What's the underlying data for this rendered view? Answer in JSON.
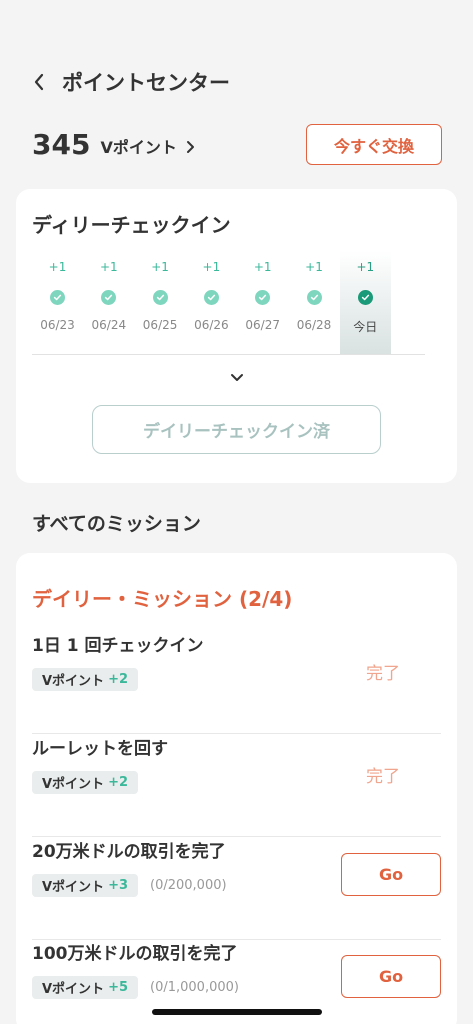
{
  "header": {
    "title": "ポイントセンター",
    "back_icon": "chevron-left-icon"
  },
  "points": {
    "value": "345",
    "unit": "Vポイント",
    "exchange_label": "今すぐ交換"
  },
  "checkin": {
    "title": "ディリーチェックイン",
    "days": [
      {
        "plus": "+1",
        "label": "06/23",
        "checked": true,
        "today": false
      },
      {
        "plus": "+1",
        "label": "06/24",
        "checked": true,
        "today": false
      },
      {
        "plus": "+1",
        "label": "06/25",
        "checked": true,
        "today": false
      },
      {
        "plus": "+1",
        "label": "06/26",
        "checked": true,
        "today": false
      },
      {
        "plus": "+1",
        "label": "06/27",
        "checked": true,
        "today": false
      },
      {
        "plus": "+1",
        "label": "06/28",
        "checked": true,
        "today": false
      },
      {
        "plus": "+1",
        "label": "今日",
        "checked": true,
        "today": true
      }
    ],
    "expand_icon": "chevron-down-icon",
    "button_label": "デイリーチェックイン済"
  },
  "missions": {
    "section_title": "すべてのミッション",
    "daily_title": "デイリー・ミッション (2/4)",
    "items": [
      {
        "title": "1日 1 回チェックイン",
        "reward_label": "Vポイント",
        "reward_amount": "+2",
        "status": "完了"
      },
      {
        "title": "ルーレットを回す",
        "reward_label": "Vポイント",
        "reward_amount": "+2",
        "status": "完了"
      },
      {
        "title": "20万米ドルの取引を完了",
        "reward_label": "Vポイント",
        "reward_amount": "+3",
        "progress": "(0/200,000)",
        "action": "Go"
      },
      {
        "title": "100万米ドルの取引を完了",
        "reward_label": "Vポイント",
        "reward_amount": "+5",
        "progress": "(0/1,000,000)",
        "action": "Go"
      }
    ]
  },
  "colors": {
    "accent": "#e0623f",
    "green": "#3bb89a",
    "done": "#f0a58e"
  }
}
